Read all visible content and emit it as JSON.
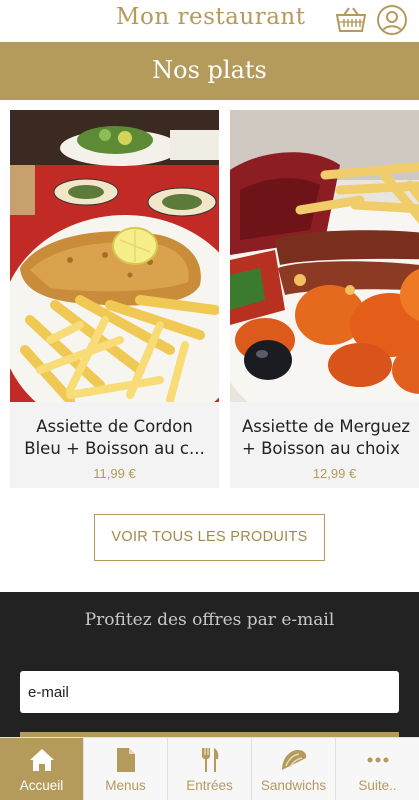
{
  "header": {
    "title": "Mon restaurant",
    "cart_icon": "basket-icon",
    "user_icon": "user-icon"
  },
  "section": {
    "title": "Nos plats"
  },
  "products": [
    {
      "name_line1": "Assiette de Cordon",
      "name_line2": "Bleu + Boisson au c...",
      "price": "11,99 €",
      "image": "cordon-bleu-fries-photo"
    },
    {
      "name_line1": "Assiette de Merguez",
      "name_line2": "+ Boisson au choix",
      "price": "12,99 €",
      "image": "merguez-fries-photo"
    }
  ],
  "see_all": {
    "label": "VOIR TOUS LES PRODUITS"
  },
  "newsletter": {
    "title": "Profitez des offres par e-mail",
    "email_placeholder": "e-mail"
  },
  "tabs": [
    {
      "label": "Accueil",
      "icon": "home-icon",
      "active": true
    },
    {
      "label": "Menus",
      "icon": "document-icon",
      "active": false
    },
    {
      "label": "Entrées",
      "icon": "fork-knife-icon",
      "active": false
    },
    {
      "label": "Sandwichs",
      "icon": "taco-icon",
      "active": false
    },
    {
      "label": "Suite..",
      "icon": "more-icon",
      "active": false
    }
  ],
  "colors": {
    "accent": "#b49b5b",
    "dark": "#222222",
    "card_bg": "#f3f3f3"
  }
}
